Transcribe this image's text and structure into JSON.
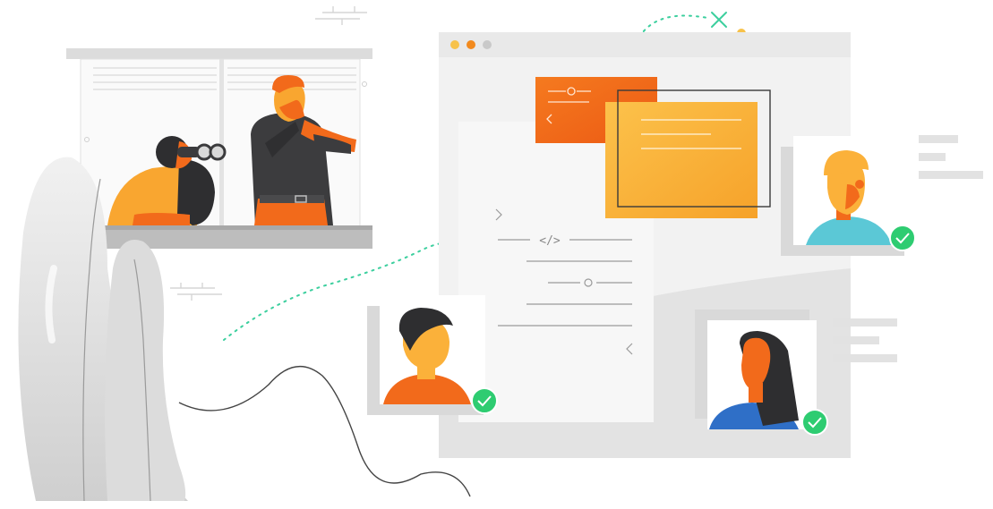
{
  "illustration": {
    "window_dots": [
      {
        "name": "dot-yellow",
        "color": "#f7c24a"
      },
      {
        "name": "dot-orange",
        "color": "#f28a1e"
      },
      {
        "name": "dot-gray",
        "color": "#c9c9c9"
      }
    ],
    "code_tag": "</>",
    "profile_badges": [
      {
        "name": "profile-top-right",
        "status": "verified",
        "color": "#2ecc71"
      },
      {
        "name": "profile-left",
        "status": "verified",
        "color": "#2ecc71"
      },
      {
        "name": "profile-bottom-right",
        "status": "verified",
        "color": "#2ecc71"
      }
    ],
    "accent_colors": {
      "orange": "#f26a1b",
      "amber": "#fbb13a",
      "teal": "#5bc8d6",
      "green": "#2ecc71",
      "gray": "#e8e8e8"
    },
    "icons": [
      "binoculars-icon",
      "close-icon",
      "check-icon",
      "chevron-left-icon",
      "chevron-right-icon",
      "code-icon"
    ]
  }
}
